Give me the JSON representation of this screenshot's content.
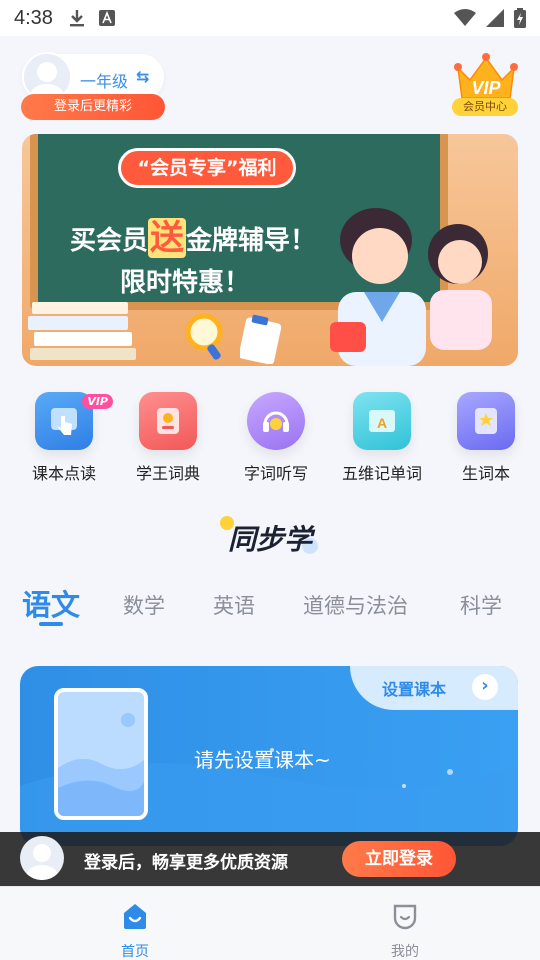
{
  "status_bar": {
    "time": "4:38"
  },
  "header": {
    "grade": "一年级",
    "grade_switch_icon": "swap-arrows-icon",
    "login_prompt": "登录后更精彩",
    "vip_badge_text": "VIP",
    "vip_center_label": "会员中心"
  },
  "banner": {
    "tag": "“会员专享”福利",
    "line1_pre": "买会员",
    "line1_highlight": "送",
    "line1_post": "金牌辅导！",
    "line2": "限时特惠！"
  },
  "quick_entries": [
    {
      "label": "课本点读",
      "icon": "finger-tap-icon",
      "badge": "VIP"
    },
    {
      "label": "学王词典",
      "icon": "dictionary-icon"
    },
    {
      "label": "字词听写",
      "icon": "headphones-pen-icon"
    },
    {
      "label": "五维记单词",
      "icon": "word-book-icon"
    },
    {
      "label": "生词本",
      "icon": "star-book-icon"
    }
  ],
  "section_title": "同步学",
  "tabs": [
    {
      "label": "语文",
      "active": true
    },
    {
      "label": "数学"
    },
    {
      "label": "英语"
    },
    {
      "label": "道德与法治"
    },
    {
      "label": "科学"
    }
  ],
  "textbook_card": {
    "set_label": "设置课本",
    "prompt": "请先设置课本~"
  },
  "login_bar": {
    "text": "登录后，畅享更多优质资源",
    "button": "立即登录"
  },
  "bottom_nav": [
    {
      "label": "首页",
      "icon": "home-icon",
      "active": true
    },
    {
      "label": "我的",
      "icon": "profile-face-icon"
    }
  ],
  "colors": {
    "accent_blue": "#2f8be8",
    "cta_orange": "#ff5636",
    "vip_gold": "#ffd23a"
  }
}
